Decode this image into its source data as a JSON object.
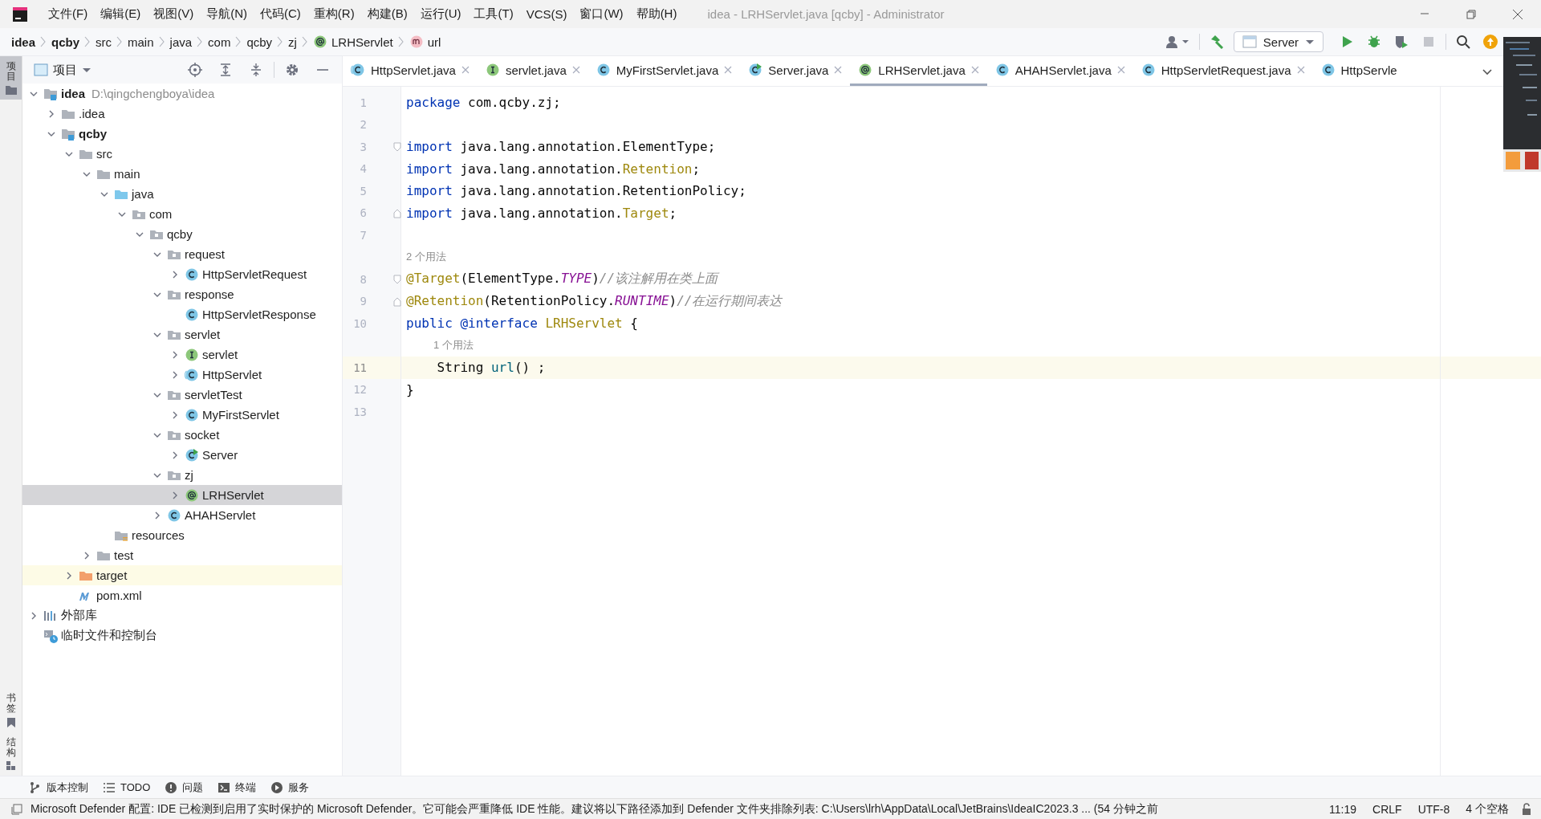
{
  "title_bar": {
    "menus": [
      "文件(F)",
      "编辑(E)",
      "视图(V)",
      "导航(N)",
      "代码(C)",
      "重构(R)",
      "构建(B)",
      "运行(U)",
      "工具(T)",
      "VCS(S)",
      "窗口(W)",
      "帮助(H)"
    ],
    "title": "idea - LRHServlet.java [qcby] - Administrator"
  },
  "breadcrumbs": [
    {
      "label": "idea",
      "kind": "module"
    },
    {
      "label": "qcby",
      "kind": "module"
    },
    {
      "label": "src",
      "kind": "folder"
    },
    {
      "label": "main",
      "kind": "folder"
    },
    {
      "label": "java",
      "kind": "folder"
    },
    {
      "label": "com",
      "kind": "folder"
    },
    {
      "label": "qcby",
      "kind": "folder"
    },
    {
      "label": "zj",
      "kind": "folder"
    },
    {
      "label": "LRHServlet",
      "kind": "annotation"
    },
    {
      "label": "url",
      "kind": "method"
    }
  ],
  "toolbar": {
    "run_config": "Server"
  },
  "side_strip": {
    "top": [
      {
        "label": "项目",
        "selected": true
      }
    ],
    "bottom": [
      {
        "label": "书签",
        "selected": false
      },
      {
        "label": "结构",
        "selected": false
      }
    ]
  },
  "project_panel": {
    "title": "项目",
    "tree": [
      {
        "label": "idea",
        "hint": "D:\\qingchengboya\\idea",
        "kind": "module",
        "expanded": true,
        "selected": false,
        "children": [
          {
            "label": ".idea",
            "kind": "folder",
            "expanded": false,
            "selected": false
          },
          {
            "label": "qcby",
            "kind": "module",
            "expanded": true,
            "selected": false,
            "children": [
              {
                "label": "src",
                "kind": "folder",
                "expanded": true,
                "selected": false,
                "children": [
                  {
                    "label": "main",
                    "kind": "folder",
                    "expanded": true,
                    "selected": false,
                    "children": [
                      {
                        "label": "java",
                        "kind": "source",
                        "expanded": true,
                        "selected": false,
                        "children": [
                          {
                            "label": "com",
                            "kind": "package",
                            "expanded": true,
                            "selected": false,
                            "children": [
                              {
                                "label": "qcby",
                                "kind": "package",
                                "expanded": true,
                                "selected": false,
                                "children": [
                                  {
                                    "label": "request",
                                    "kind": "package",
                                    "expanded": true,
                                    "selected": false,
                                    "children": [
                                      {
                                        "label": "HttpServletRequest",
                                        "kind": "class",
                                        "expanded": false,
                                        "selected": false
                                      }
                                    ]
                                  },
                                  {
                                    "label": "response",
                                    "kind": "package",
                                    "expanded": true,
                                    "selected": false,
                                    "children": [
                                      {
                                        "label": "HttpServletResponse",
                                        "kind": "class",
                                        "selected": false
                                      }
                                    ]
                                  },
                                  {
                                    "label": "servlet",
                                    "kind": "package",
                                    "expanded": true,
                                    "selected": false,
                                    "children": [
                                      {
                                        "label": "servlet",
                                        "kind": "interface",
                                        "expanded": false,
                                        "selected": false
                                      },
                                      {
                                        "label": "HttpServlet",
                                        "kind": "abstract",
                                        "expanded": false,
                                        "selected": false
                                      }
                                    ]
                                  },
                                  {
                                    "label": "servletTest",
                                    "kind": "package",
                                    "expanded": true,
                                    "selected": false,
                                    "children": [
                                      {
                                        "label": "MyFirstServlet",
                                        "kind": "class",
                                        "expanded": false,
                                        "selected": false
                                      }
                                    ]
                                  },
                                  {
                                    "label": "socket",
                                    "kind": "package",
                                    "expanded": true,
                                    "selected": false,
                                    "children": [
                                      {
                                        "label": "Server",
                                        "kind": "runnable",
                                        "expanded": false,
                                        "selected": false
                                      }
                                    ]
                                  },
                                  {
                                    "label": "zj",
                                    "kind": "package",
                                    "expanded": true,
                                    "selected": false,
                                    "children": [
                                      {
                                        "label": "LRHServlet",
                                        "kind": "annotation",
                                        "expanded": false,
                                        "selected": true
                                      }
                                    ]
                                  },
                                  {
                                    "label": "AHAHServlet",
                                    "kind": "class",
                                    "expanded": false,
                                    "selected": false
                                  }
                                ]
                              }
                            ]
                          }
                        ]
                      },
                      {
                        "label": "resources",
                        "kind": "resources",
                        "selected": false
                      }
                    ]
                  },
                  {
                    "label": "test",
                    "kind": "folder",
                    "expanded": false,
                    "selected": false
                  }
                ]
              },
              {
                "label": "target",
                "kind": "excluded",
                "expanded": false,
                "selected": false
              },
              {
                "label": "pom.xml",
                "kind": "maven",
                "selected": false
              }
            ]
          }
        ]
      },
      {
        "label": "外部库",
        "kind": "library",
        "expanded": false,
        "selected": false
      },
      {
        "label": "临时文件和控制台",
        "kind": "scratch",
        "selected": false
      }
    ]
  },
  "editor_tabs": [
    {
      "label": "HttpServlet.java",
      "kind": "abstract",
      "selected": false,
      "closable": true
    },
    {
      "label": "servlet.java",
      "kind": "interface",
      "selected": false,
      "closable": true
    },
    {
      "label": "MyFirstServlet.java",
      "kind": "class",
      "selected": false,
      "closable": true
    },
    {
      "label": "Server.java",
      "kind": "runnable",
      "selected": false,
      "closable": true
    },
    {
      "label": "LRHServlet.java",
      "kind": "annotation",
      "selected": true,
      "closable": true
    },
    {
      "label": "AHAHServlet.java",
      "kind": "class",
      "selected": false,
      "closable": true
    },
    {
      "label": "HttpServletRequest.java",
      "kind": "class",
      "selected": false,
      "closable": true
    },
    {
      "label": "HttpServle",
      "kind": "class",
      "selected": false,
      "closable": false
    }
  ],
  "editor": {
    "lines": [
      {
        "kind": "code",
        "number": "1",
        "current": false,
        "tokens": [
          {
            "kind": "keyword",
            "text": "package"
          },
          {
            "kind": "plain",
            "text": " com.qcby.zj;"
          }
        ]
      },
      {
        "kind": "code",
        "number": "2",
        "current": false
      },
      {
        "kind": "fold-start",
        "number": "3",
        "current": false,
        "tokens": [
          {
            "kind": "keyword",
            "text": "import"
          },
          {
            "kind": "plain",
            "text": " java.lang.annotation.ElementType;"
          }
        ]
      },
      {
        "kind": "code",
        "number": "4",
        "current": false,
        "tokens": [
          {
            "kind": "keyword",
            "text": "import"
          },
          {
            "kind": "plain",
            "text": " java.lang.annotation."
          },
          {
            "kind": "annotation",
            "text": "Retention"
          },
          {
            "kind": "plain",
            "text": ";"
          }
        ]
      },
      {
        "kind": "code",
        "number": "5",
        "current": false,
        "tokens": [
          {
            "kind": "keyword",
            "text": "import"
          },
          {
            "kind": "plain",
            "text": " java.lang.annotation.RetentionPolicy;"
          }
        ]
      },
      {
        "kind": "fold-end",
        "number": "6",
        "current": false,
        "tokens": [
          {
            "kind": "keyword",
            "text": "import"
          },
          {
            "kind": "plain",
            "text": " java.lang.annotation."
          },
          {
            "kind": "annotation",
            "text": "Target"
          },
          {
            "kind": "plain",
            "text": ";"
          }
        ]
      },
      {
        "kind": "code",
        "number": "7",
        "current": false
      },
      {
        "kind": "hint",
        "text": "2 个用法",
        "indented": false
      },
      {
        "kind": "fold-start",
        "number": "8",
        "current": false,
        "tokens": [
          {
            "kind": "annotation",
            "text": "@Target"
          },
          {
            "kind": "plain",
            "text": "(ElementType."
          },
          {
            "kind": "static",
            "text": "TYPE"
          },
          {
            "kind": "plain",
            "text": ")"
          },
          {
            "kind": "comment",
            "text": "//该注解用在类上面"
          }
        ]
      },
      {
        "kind": "fold-end",
        "number": "9",
        "current": false,
        "tokens": [
          {
            "kind": "annotation",
            "text": "@Retention"
          },
          {
            "kind": "plain",
            "text": "(RetentionPolicy."
          },
          {
            "kind": "static",
            "text": "RUNTIME"
          },
          {
            "kind": "plain",
            "text": ")"
          },
          {
            "kind": "comment",
            "text": "//在运行期间表达"
          }
        ]
      },
      {
        "kind": "code",
        "number": "10",
        "current": false,
        "tokens": [
          {
            "kind": "keyword",
            "text": "public @interface"
          },
          {
            "kind": "annotation",
            "text": " LRHServlet"
          },
          {
            "kind": "plain",
            "text": " {"
          }
        ]
      },
      {
        "kind": "hint",
        "text": "1 个用法",
        "indented": true
      },
      {
        "kind": "code",
        "number": "11",
        "current": true,
        "tokens": [
          {
            "kind": "plain",
            "text": "    String "
          },
          {
            "kind": "method",
            "text": "url"
          },
          {
            "kind": "plain",
            "text": "() ;"
          }
        ]
      },
      {
        "kind": "code",
        "number": "12",
        "current": false,
        "tokens": [
          {
            "kind": "plain",
            "text": "}"
          }
        ]
      },
      {
        "kind": "code",
        "number": "13",
        "current": false
      }
    ]
  },
  "tool_windows": [
    {
      "label": "版本控制",
      "kind": "branch"
    },
    {
      "label": "TODO",
      "kind": "list"
    },
    {
      "label": "问题",
      "kind": "problem"
    },
    {
      "label": "终端",
      "kind": "terminal"
    },
    {
      "label": "服务",
      "kind": "services"
    }
  ],
  "status_bar": {
    "message": "Microsoft Defender 配置: IDE 已检测到启用了实时保护的 Microsoft Defender。它可能会严重降低 IDE 性能。建议将以下路径添加到 Defender 文件夹排除列表: C:\\Users\\lrh\\AppData\\Local\\JetBrains\\IdeaIC2023.3 ... (54 分钟之前",
    "items": [
      "11:19",
      "CRLF",
      "UTF-8",
      "4 个空格"
    ]
  }
}
